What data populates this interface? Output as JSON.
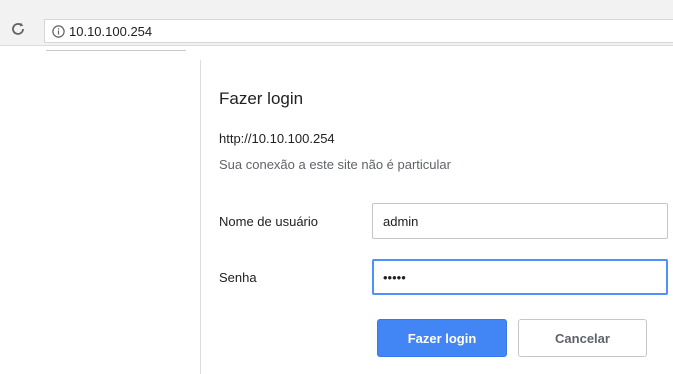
{
  "browser": {
    "reload_icon": "reload-icon",
    "info_icon": "info-icon",
    "address": "10.10.100.254"
  },
  "dialog": {
    "title": "Fazer login",
    "origin": "http://10.10.100.254",
    "warning": "Sua conexão a este site não é particular",
    "username_label": "Nome de usuário",
    "username_value": "admin",
    "password_label": "Senha",
    "password_value": "•••••",
    "login_button": "Fazer login",
    "cancel_button": "Cancelar"
  },
  "colors": {
    "primary_button": "#4285f4",
    "focus_border": "#4d90fe"
  }
}
